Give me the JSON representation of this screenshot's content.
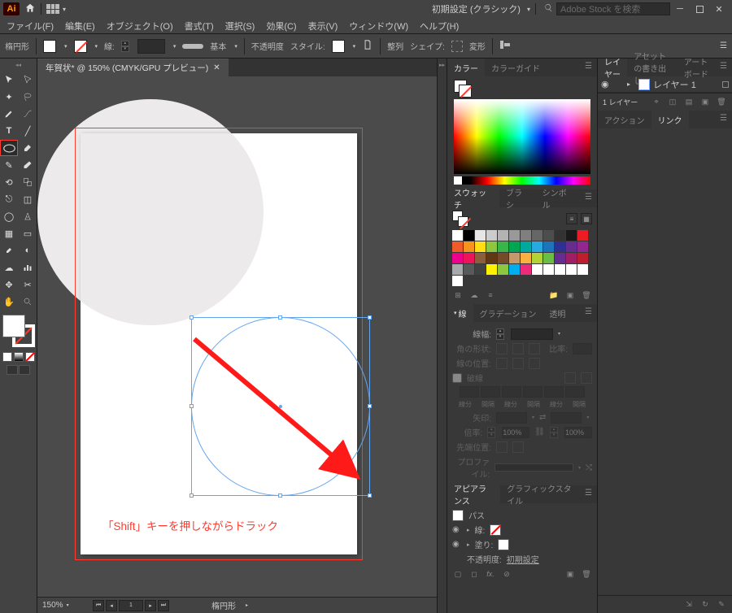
{
  "app": {
    "logo": "Ai"
  },
  "titlebar": {
    "workspace": "初期設定 (クラシック)",
    "search_placeholder": "Adobe Stock を検索"
  },
  "menu": {
    "file": "ファイル(F)",
    "edit": "編集(E)",
    "object": "オブジェクト(O)",
    "type": "書式(T)",
    "select": "選択(S)",
    "effect": "効果(C)",
    "view": "表示(V)",
    "window": "ウィンドウ(W)",
    "help": "ヘルプ(H)"
  },
  "ctrl": {
    "tool_label": "楕円形",
    "stroke_label": "線:",
    "stroke_width": "",
    "opacity_label": "不透明度",
    "style_label": "スタイル:",
    "align_label": "整列",
    "shape_label": "シェイプ:",
    "transform_label": "変形",
    "basic_label": "基本",
    "stroke_uniform": "—"
  },
  "document": {
    "tab_title": "年賀状* @ 150% (CMYK/GPU プレビュー)",
    "zoom": "150%",
    "status_tool": "楕円形"
  },
  "canvas": {
    "instruction": "「Shift」キーを押しながらドラック"
  },
  "panels": {
    "color": {
      "tab_color": "カラー",
      "tab_guide": "カラーガイド"
    },
    "swatches": {
      "tab_swatches": "スウォッチ",
      "tab_brush": "ブラシ",
      "tab_symbol": "シンボル"
    },
    "stroke": {
      "tab_line": "線",
      "tab_gradient": "グラデーション",
      "tab_trans": "透明",
      "width_label": "線幅:",
      "cap_label": "角の形状:",
      "ratio_label": "比率:",
      "align_label": "線の位置:",
      "dash_check": "破線",
      "dash_headers": [
        "線分",
        "間隔",
        "線分",
        "間隔",
        "線分",
        "間隔"
      ],
      "arrow_label": "矢印:",
      "scale_label": "倍率:",
      "scale_val1": "100%",
      "scale_val2": "100%",
      "tip_label": "先端位置:",
      "profile_label": "プロファイル:"
    },
    "appearance": {
      "tab_appear": "アピアランス",
      "tab_gstyle": "グラフィックスタイル",
      "path_label": "パス",
      "stroke_label": "線:",
      "fill_label": "塗り:",
      "opacity_label": "不透明度:",
      "opacity_value": "初期設定"
    },
    "layers": {
      "tab_layers": "レイヤー",
      "tab_asset": "アセットの書き出し",
      "tab_artboard": "アートボード",
      "layer1": "レイヤー 1",
      "count_label": "1 レイヤー"
    },
    "links": {
      "tab_action": "アクション",
      "tab_link": "リンク"
    }
  },
  "swatch_colors": [
    "#ffffff",
    "#000000",
    "#e6e6e6",
    "#cccccc",
    "#b3b3b3",
    "#999999",
    "#7f7f7f",
    "#666666",
    "#4d4d4d",
    "#333333",
    "#1a1a1a",
    "#ed1c24",
    "#f15a29",
    "#f7941d",
    "#ffde17",
    "#8dc63f",
    "#39b54a",
    "#00a651",
    "#00a99d",
    "#27aae1",
    "#1c75bc",
    "#2e3192",
    "#662d91",
    "#92278f",
    "#ec008c",
    "#ed145b",
    "#8b5e3c",
    "#603913",
    "#754c29",
    "#c49a6c",
    "#fbb040",
    "#b2d235",
    "#6abd45",
    "#662d91",
    "#9e1f63",
    "#be1e2d",
    "#a7a9ac",
    "#58595b",
    "#414042",
    "#fff200",
    "#8dc63f",
    "#00aeef",
    "#ee2a7b",
    "#ffffff",
    "#ffffff",
    "#ffffff",
    "#ffffff",
    "#ffffff",
    "#ffffff"
  ]
}
